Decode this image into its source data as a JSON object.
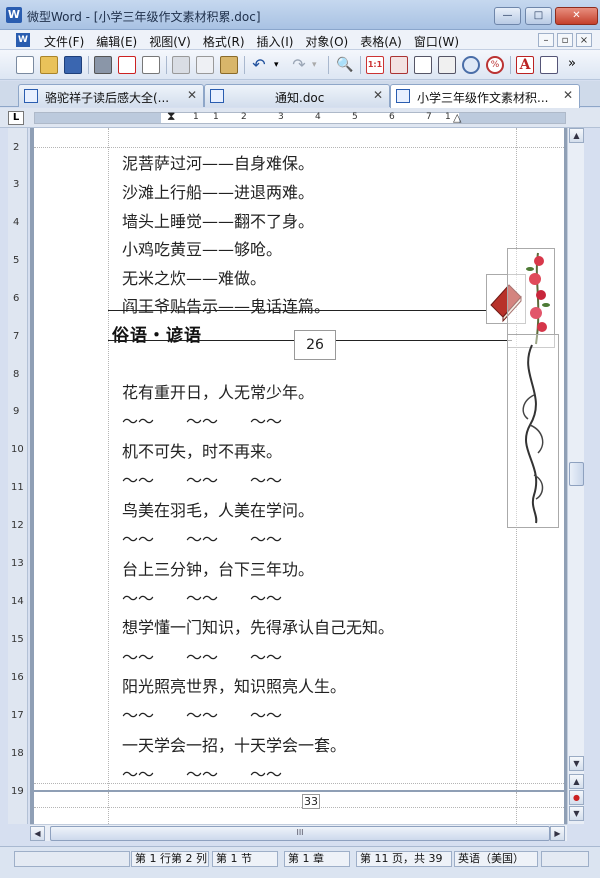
{
  "window": {
    "app_icon": "W",
    "title": "微型Word - [小学三年级作文素材积累.doc]",
    "minimize": "—",
    "maximize": "□",
    "close": "✕"
  },
  "menu": {
    "items": [
      "文件(F)",
      "编辑(E)",
      "视图(V)",
      "格式(R)",
      "插入(I)",
      "对象(O)",
      "表格(A)",
      "窗口(W)"
    ],
    "doc_min": "–",
    "doc_restore": "▫",
    "doc_close": "×"
  },
  "toolbar": {
    "icons": [
      "new-document-icon",
      "open-folder-icon",
      "save-icon",
      "print-icon",
      "export-pdf-icon",
      "print-preview-icon",
      "cut-icon",
      "copy-icon",
      "paste-icon",
      "undo-icon",
      "redo-icon",
      "find-icon",
      "actual-size-icon",
      "page-width-icon",
      "single-page-icon",
      "two-page-icon",
      "zoom-icon",
      "percent-zoom-icon",
      "font-color-icon",
      "format-icon"
    ],
    "more": "»",
    "colors": {
      "accent": "#2a5db0"
    }
  },
  "tabs": [
    {
      "label": "骆驼祥子读后感大全(...",
      "close": "✕",
      "active": false
    },
    {
      "label": "通知.doc",
      "close": "✕",
      "active": false
    },
    {
      "label": "小学三年级作文素材积...",
      "close": "✕",
      "active": true
    }
  ],
  "ruler": {
    "corner": "L",
    "numbers": [
      "1",
      "1",
      "2",
      "3",
      "4",
      "5",
      "6",
      "7",
      "1"
    ],
    "vertical_numbers": [
      "2",
      "3",
      "4",
      "5",
      "6",
      "7",
      "8",
      "9",
      "10",
      "11",
      "12",
      "13",
      "14",
      "15",
      "16",
      "17",
      "18",
      "19"
    ]
  },
  "document": {
    "lines_top": [
      "泥菩萨过河——自身难保。",
      "沙滩上行船——进退两难。",
      "墙头上睡觉——翻不了身。",
      "小鸡吃黄豆——够呛。",
      "无米之炊——难做。",
      "阎王爷贴告示——鬼话连篇。"
    ],
    "heading": "俗语・谚语",
    "page_box": "26",
    "lines_bottom": [
      "花有重开日，人无常少年。",
      "～～　　～～　　～～",
      "机不可失，时不再来。",
      "～～　　～～　　～～",
      "鸟美在羽毛，人美在学问。",
      "～～　　～～　　～～",
      "台上三分钟，台下三年功。",
      "～～　　～～　　～～",
      "想学懂一门知识，先得承认自己无知。",
      "～～　　～～　　～～",
      "阳光照亮世界，知识照亮人生。",
      "～～　　～～　　～～",
      "一天学会一招，十天学会一套。",
      "～～　　～～　　～～"
    ],
    "page_number_footer": "33"
  },
  "scrollbar": {
    "up": "▲",
    "down": "▼",
    "prev_page": "▲",
    "browse": "●",
    "next_page": "▼",
    "left": "◀",
    "right": "▶",
    "grip": "III"
  },
  "status": {
    "position": "第 1 行第 2 列",
    "section": "第 1 节",
    "chapter": "第 1 章",
    "page": "第 11 页，共 39",
    "language": "英语（美国）"
  }
}
